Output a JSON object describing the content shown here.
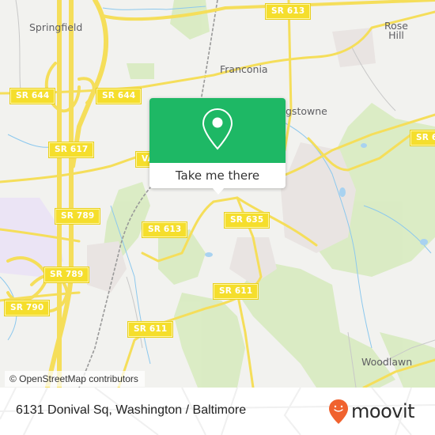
{
  "map": {
    "places": [
      {
        "id": "springfield",
        "label": "Springfield"
      },
      {
        "id": "franconia",
        "label": "Franconia"
      },
      {
        "id": "rose-hill-1",
        "label": "Rose"
      },
      {
        "id": "rose-hill-2",
        "label": "Hill"
      },
      {
        "id": "kingstowne",
        "label": "gstowne"
      },
      {
        "id": "woodlawn",
        "label": "Woodlawn"
      }
    ],
    "route_shields": [
      {
        "id": "sr-613-top",
        "label": "SR 613"
      },
      {
        "id": "sr-644-left",
        "label": "SR 644"
      },
      {
        "id": "sr-644-right",
        "label": "SR 644"
      },
      {
        "id": "sr-617",
        "label": "SR 617"
      },
      {
        "id": "va-partial",
        "label": "VA"
      },
      {
        "id": "sr-6x-right",
        "label": "SR 6"
      },
      {
        "id": "sr-789-upper",
        "label": "SR 789"
      },
      {
        "id": "sr-613-mid",
        "label": "SR 613"
      },
      {
        "id": "sr-635",
        "label": "SR 635"
      },
      {
        "id": "sr-789-lower",
        "label": "SR 789"
      },
      {
        "id": "sr-611-mid",
        "label": "SR 611"
      },
      {
        "id": "sr-790",
        "label": "SR 790"
      },
      {
        "id": "sr-611-lower",
        "label": "SR 611"
      }
    ],
    "attribution": "© OpenStreetMap contributors"
  },
  "popup": {
    "icon": "map-pin-icon",
    "button_label": "Take me there",
    "color": "#1eb865"
  },
  "footer": {
    "address": "6131 Donival Sq, Washington / Baltimore",
    "brand": "moovit",
    "brand_icon": "moovit-smiley-pin-icon",
    "brand_color": "#f0622e"
  }
}
